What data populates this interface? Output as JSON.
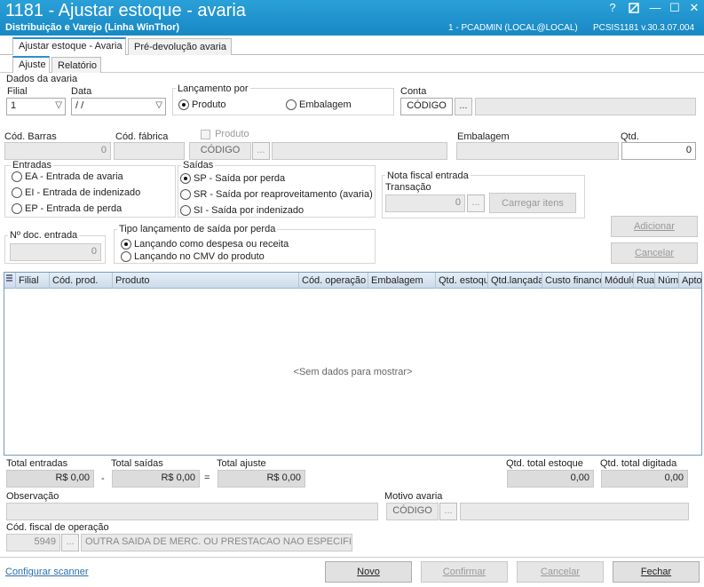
{
  "window": {
    "title": "1181 - Ajustar estoque - avaria",
    "subtitle": "Distribuição e Varejo (Linha WinThor)",
    "user_info": "1 - PCADMIN (LOCAL@LOCAL)",
    "version_info": "PCSIS1181  v.30.3.07.004",
    "help_glyph": "?",
    "minimize_glyph": "—",
    "maximize_glyph": "☐",
    "close_glyph": "✕"
  },
  "tabs_top": [
    "Ajustar estoque - Avaria",
    "Pré-devolução avaria"
  ],
  "tabs_sub": [
    "Ajuste",
    "Relatório"
  ],
  "dados": {
    "group_label": "Dados da avaria",
    "filial_label": "Filial",
    "filial_value": "1",
    "data_label": "Data",
    "data_value": " / /",
    "lancamento_label": "Lançamento por",
    "lancamento_produto": "Produto",
    "lancamento_embalagem": "Embalagem",
    "conta_label": "Conta",
    "conta_code": "CÓDIGO",
    "conta_desc": "",
    "ellipsis": "..."
  },
  "produto": {
    "cod_barras_label": "Cód. Barras",
    "cod_barras_value": "0",
    "cod_fabrica_label": "Cód. fábrica",
    "cod_fabrica_value": "",
    "produto_label": "Produto",
    "produto_code": "CÓDIGO",
    "produto_desc": "",
    "embalagem_label": "Embalagem",
    "embalagem_value": "",
    "qtd_label": "Qtd.",
    "qtd_value": "0"
  },
  "entradas": {
    "label": "Entradas",
    "options": [
      "EA - Entrada de avaria",
      "EI - Entrada de indenizado",
      "EP - Entrada de perda"
    ]
  },
  "saidas": {
    "label": "Saídas",
    "options": [
      "SP - Saída por perda",
      "SR - Saída por reaproveitamento (avaria)",
      "SI - Saída por indenizado"
    ]
  },
  "nota_fiscal": {
    "label": "Nota fiscal entrada",
    "transacao_label": "Transação",
    "transacao_value": "0",
    "carregar_label": "Carregar itens"
  },
  "actions_right": {
    "adicionar": "Adicionar",
    "cancelar": "Cancelar"
  },
  "doc_entrada": {
    "label": "Nº doc. entrada",
    "value": "0"
  },
  "tipo_lancamento": {
    "label": "Tipo lançamento de saída por perda",
    "options": [
      "Lançando como despesa ou receita",
      "Lançando no CMV do produto"
    ]
  },
  "grid": {
    "columns": [
      "Filial",
      "Cód. prod.",
      "Produto",
      "Cód. operação",
      "Embalagem",
      "Qtd. estoque",
      "Qtd.lançada",
      "Custo financeiro",
      "Módulo",
      "Rua",
      "Núm",
      "Apto"
    ],
    "empty_text": "<Sem dados para mostrar>"
  },
  "totals": {
    "entradas_label": "Total entradas",
    "entradas_value": "R$ 0,00",
    "minus": "-",
    "saidas_label": "Total saídas",
    "saidas_value": "R$ 0,00",
    "equals": "=",
    "ajuste_label": "Total ajuste",
    "ajuste_value": "R$ 0,00",
    "qtd_estoque_label": "Qtd. total estoque",
    "qtd_estoque_value": "0,00",
    "qtd_digitada_label": "Qtd. total digitada",
    "qtd_digitada_value": "0,00"
  },
  "observacao": {
    "label": "Observação",
    "value": ""
  },
  "motivo": {
    "label": "Motivo avaria",
    "code": "CÓDIGO",
    "desc": ""
  },
  "cfop": {
    "label": "Cód. fiscal de operação",
    "code": "5949",
    "desc": "OUTRA SAIDA DE MERC. OU PRESTACAO NAO ESPECIFICADO"
  },
  "footer": {
    "configurar_scanner": "Configurar scanner",
    "novo": "Novo",
    "confirmar": "Confirmar",
    "cancelar": "Cancelar",
    "fechar": "Fechar"
  }
}
